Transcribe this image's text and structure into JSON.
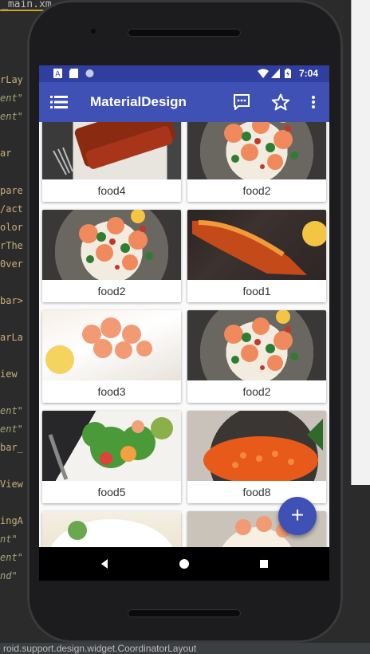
{
  "ide": {
    "tab_label": "_main.xm",
    "status_text": "roid.support.design.widget.CoordinatorLayout",
    "code_fragments": [
      "rLay",
      "ent\"",
      "ent\"",
      "ar",
      "pare",
      "/act",
      "olor",
      "rThe",
      "0ver",
      "bar>",
      "arLa",
      "iew",
      "ent\"",
      "ent\"",
      "bar_",
      "View",
      "ingA",
      "nt\"",
      "ent\"",
      "nd\""
    ]
  },
  "status_bar": {
    "time": "7:04"
  },
  "toolbar": {
    "title": "MaterialDesign",
    "menu_icon": "list-menu-icon",
    "actions": [
      "message-icon",
      "star-icon",
      "overflow-menu-icon"
    ]
  },
  "cards": [
    {
      "label": "food4",
      "image": "food4"
    },
    {
      "label": "food2",
      "image": "food2"
    },
    {
      "label": "food2",
      "image": "food2"
    },
    {
      "label": "food1",
      "image": "food1"
    },
    {
      "label": "food3",
      "image": "food3"
    },
    {
      "label": "food2",
      "image": "food2"
    },
    {
      "label": "food5",
      "image": "food5"
    },
    {
      "label": "food8",
      "image": "food8"
    },
    {
      "label": "",
      "image": "foodA"
    },
    {
      "label": "",
      "image": "foodB"
    }
  ],
  "fab": {
    "label": "+"
  },
  "colors": {
    "primary": "#3f51b5",
    "primary_dark": "#303f9f"
  }
}
